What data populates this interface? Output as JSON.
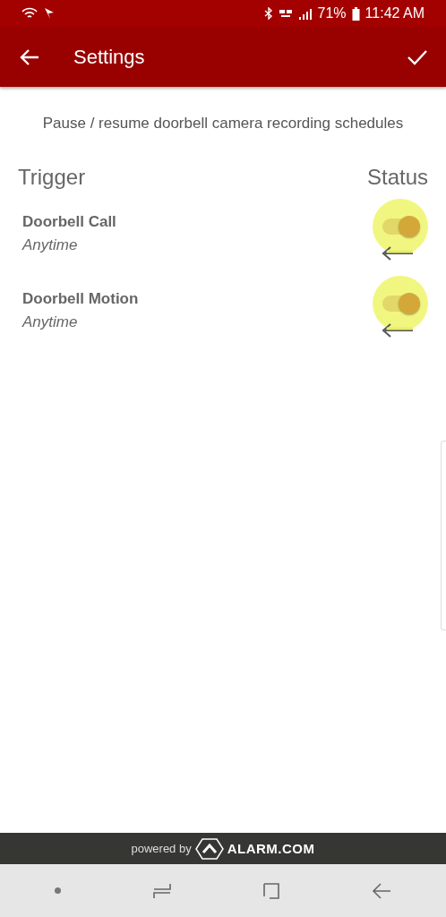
{
  "status_bar": {
    "battery": "71%",
    "time": "11:42 AM"
  },
  "app_bar": {
    "title": "Settings"
  },
  "description": "Pause / resume doorbell camera recording schedules",
  "columns": [
    "Trigger",
    "Status"
  ],
  "triggers": [
    {
      "name": "Doorbell Call",
      "schedule": "Anytime",
      "on": true,
      "highlighted": true
    },
    {
      "name": "Doorbell Motion",
      "schedule": "Anytime",
      "on": true,
      "highlighted": true
    }
  ],
  "footer": {
    "powered_by": "powered by",
    "brand": "ALARM.COM"
  }
}
